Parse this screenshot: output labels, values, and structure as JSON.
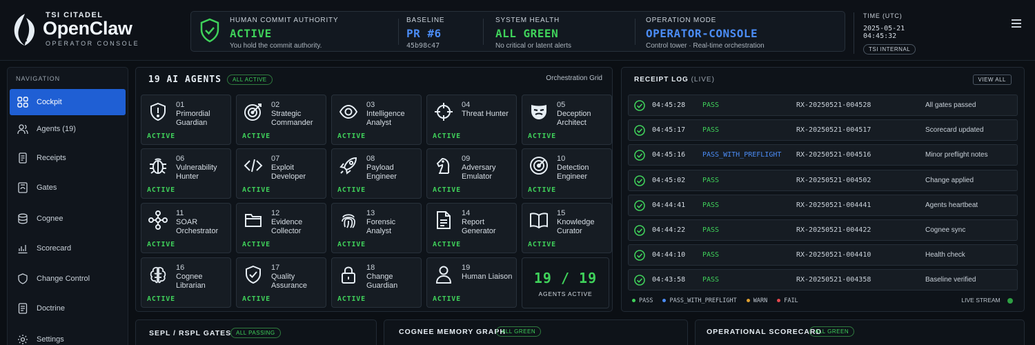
{
  "brand": {
    "org": "TSI CITADEL",
    "name": "OpenClaw",
    "subtitle": "OPERATOR CONSOLE"
  },
  "status": {
    "authority": {
      "label": "HUMAN COMMIT AUTHORITY",
      "value": "ACTIVE",
      "sub": "You hold the commit authority."
    },
    "baseline": {
      "label": "BASELINE",
      "value": "PR #6",
      "sub": "45b98c47"
    },
    "health": {
      "label": "SYSTEM HEALTH",
      "value": "ALL GREEN",
      "sub": "No critical or latent alerts"
    },
    "mode": {
      "label": "OPERATION MODE",
      "value": "OPERATOR-CONSOLE",
      "sub": "Control tower  ·  Real-time orchestration"
    }
  },
  "time": {
    "label": "TIME (UTC)",
    "value": "2025-05-21 04:45:32",
    "badge": "TSI INTERNAL"
  },
  "sidebar": {
    "title": "NAVIGATION",
    "items": [
      {
        "label": "Cockpit",
        "icon": "grid-icon",
        "active": true
      },
      {
        "label": "Agents (19)",
        "icon": "users-icon"
      },
      {
        "label": "Receipts",
        "icon": "receipt-icon"
      },
      {
        "label": "Gates",
        "icon": "gate-icon"
      },
      {
        "label": "Cognee",
        "icon": "database-icon"
      },
      {
        "label": "Scorecard",
        "icon": "chart-icon"
      },
      {
        "label": "Change Control",
        "icon": "shield-icon"
      },
      {
        "label": "Doctrine",
        "icon": "book-icon"
      },
      {
        "label": "Settings",
        "icon": "gear-icon"
      }
    ]
  },
  "agents": {
    "title": "19 AI AGENTS",
    "badge": "ALL ACTIVE",
    "subtitle": "Orchestration Grid",
    "status_label": "ACTIVE",
    "count": {
      "value": "19 / 19",
      "label": "AGENTS ACTIVE"
    },
    "items": [
      {
        "num": "01",
        "name": "Primordial Guardian",
        "icon": "exclamation-shield-icon"
      },
      {
        "num": "02",
        "name": "Strategic Commander",
        "icon": "target-icon"
      },
      {
        "num": "03",
        "name": "Intelligence Analyst",
        "icon": "eye-icon"
      },
      {
        "num": "04",
        "name": "Threat Hunter",
        "icon": "crosshair-icon"
      },
      {
        "num": "05",
        "name": "Deception Architect",
        "icon": "mask-icon"
      },
      {
        "num": "06",
        "name": "Vulnerability Hunter",
        "icon": "bug-icon"
      },
      {
        "num": "07",
        "name": "Exploit Developer",
        "icon": "code-icon"
      },
      {
        "num": "08",
        "name": "Payload Engineer",
        "icon": "rocket-icon"
      },
      {
        "num": "09",
        "name": "Adversary Emulator",
        "icon": "chess-knight-icon"
      },
      {
        "num": "10",
        "name": "Detection Engineer",
        "icon": "radar-icon"
      },
      {
        "num": "11",
        "name": "SOAR Orchestrator",
        "icon": "network-icon"
      },
      {
        "num": "12",
        "name": "Evidence Collector",
        "icon": "folder-icon"
      },
      {
        "num": "13",
        "name": "Forensic Analyst",
        "icon": "fingerprint-icon"
      },
      {
        "num": "14",
        "name": "Report Generator",
        "icon": "document-icon"
      },
      {
        "num": "15",
        "name": "Knowledge Curator",
        "icon": "book-icon"
      },
      {
        "num": "16",
        "name": "Cognee Librarian",
        "icon": "brain-icon"
      },
      {
        "num": "17",
        "name": "Quality Assurance",
        "icon": "check-shield-icon"
      },
      {
        "num": "18",
        "name": "Change Guardian",
        "icon": "lock-icon"
      },
      {
        "num": "19",
        "name": "Human Liaison",
        "icon": "person-icon"
      }
    ]
  },
  "receipts": {
    "title": "RECEIPT LOG",
    "live": "(LIVE)",
    "view_all": "VIEW ALL",
    "rows": [
      {
        "time": "04:45:28",
        "status": "PASS",
        "id": "RX-20250521-004528",
        "note": "All gates passed"
      },
      {
        "time": "04:45:17",
        "status": "PASS",
        "id": "RX-20250521-004517",
        "note": "Scorecard updated"
      },
      {
        "time": "04:45:16",
        "status": "PASS_WITH_PREFLIGHT",
        "id": "RX-20250521-004516",
        "note": "Minor preflight notes"
      },
      {
        "time": "04:45:02",
        "status": "PASS",
        "id": "RX-20250521-004502",
        "note": "Change applied"
      },
      {
        "time": "04:44:41",
        "status": "PASS",
        "id": "RX-20250521-004441",
        "note": "Agents heartbeat"
      },
      {
        "time": "04:44:22",
        "status": "PASS",
        "id": "RX-20250521-004422",
        "note": "Cognee sync"
      },
      {
        "time": "04:44:10",
        "status": "PASS",
        "id": "RX-20250521-004410",
        "note": "Health check"
      },
      {
        "time": "04:43:58",
        "status": "PASS",
        "id": "RX-20250521-004358",
        "note": "Baseline verified"
      }
    ],
    "legend": [
      {
        "label": "PASS",
        "color": "#3fd15a"
      },
      {
        "label": "PASS_WITH_PREFLIGHT",
        "color": "#4b8cf5"
      },
      {
        "label": "WARN",
        "color": "#e0a030"
      },
      {
        "label": "FAIL",
        "color": "#e5484d"
      }
    ],
    "stream_label": "LIVE STREAM"
  },
  "bottom_panels": [
    {
      "title": "SEPL / RSPL GATES",
      "badge": "ALL PASSING"
    },
    {
      "title": "COGNEE MEMORY GRAPH",
      "badge": "ALL GREEN"
    },
    {
      "title": "OPERATIONAL SCORECARD",
      "badge": "ALL GREEN"
    }
  ],
  "colors": {
    "green": "#3fd15a",
    "blue": "#4b8cf5",
    "accent": "#1f5fd4"
  }
}
